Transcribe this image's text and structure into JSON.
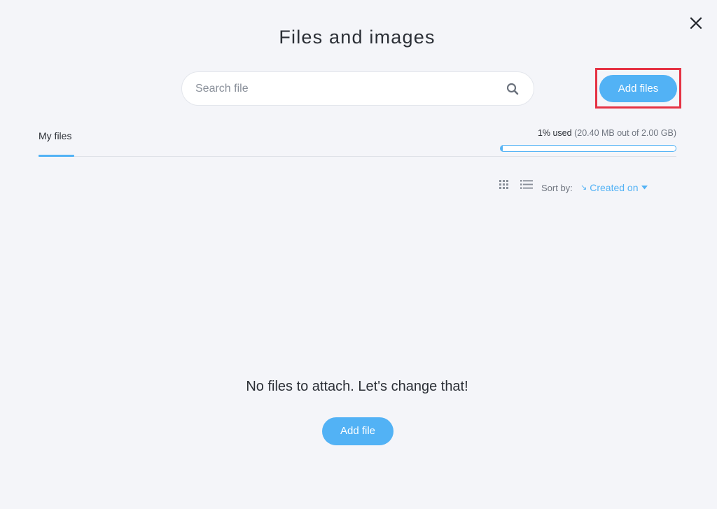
{
  "modal": {
    "title": "Files and images",
    "close_icon": "close-icon"
  },
  "search": {
    "placeholder": "Search file",
    "value": "",
    "icon": "search-icon"
  },
  "toolbar": {
    "add_files_label": "Add files",
    "highlight_color": "#e53244"
  },
  "tabs": [
    {
      "label": "My files",
      "active": true
    }
  ],
  "storage": {
    "used_label": "1% used",
    "detail_label": "(20.40 MB out of 2.00 GB)",
    "used_fraction": 0.01
  },
  "view": {
    "grid_icon": "grid-view-icon",
    "list_icon": "list-view-icon",
    "sort_label": "Sort by:",
    "sort_value": "Created on",
    "sort_direction_icon": "sort-descending-icon",
    "dropdown_icon": "caret-down-icon"
  },
  "empty_state": {
    "message": "No files to attach. Let's change that!",
    "button_label": "Add file"
  },
  "colors": {
    "accent": "#52b2f5",
    "background": "#f4f5f9",
    "text": "#2b2f36"
  }
}
